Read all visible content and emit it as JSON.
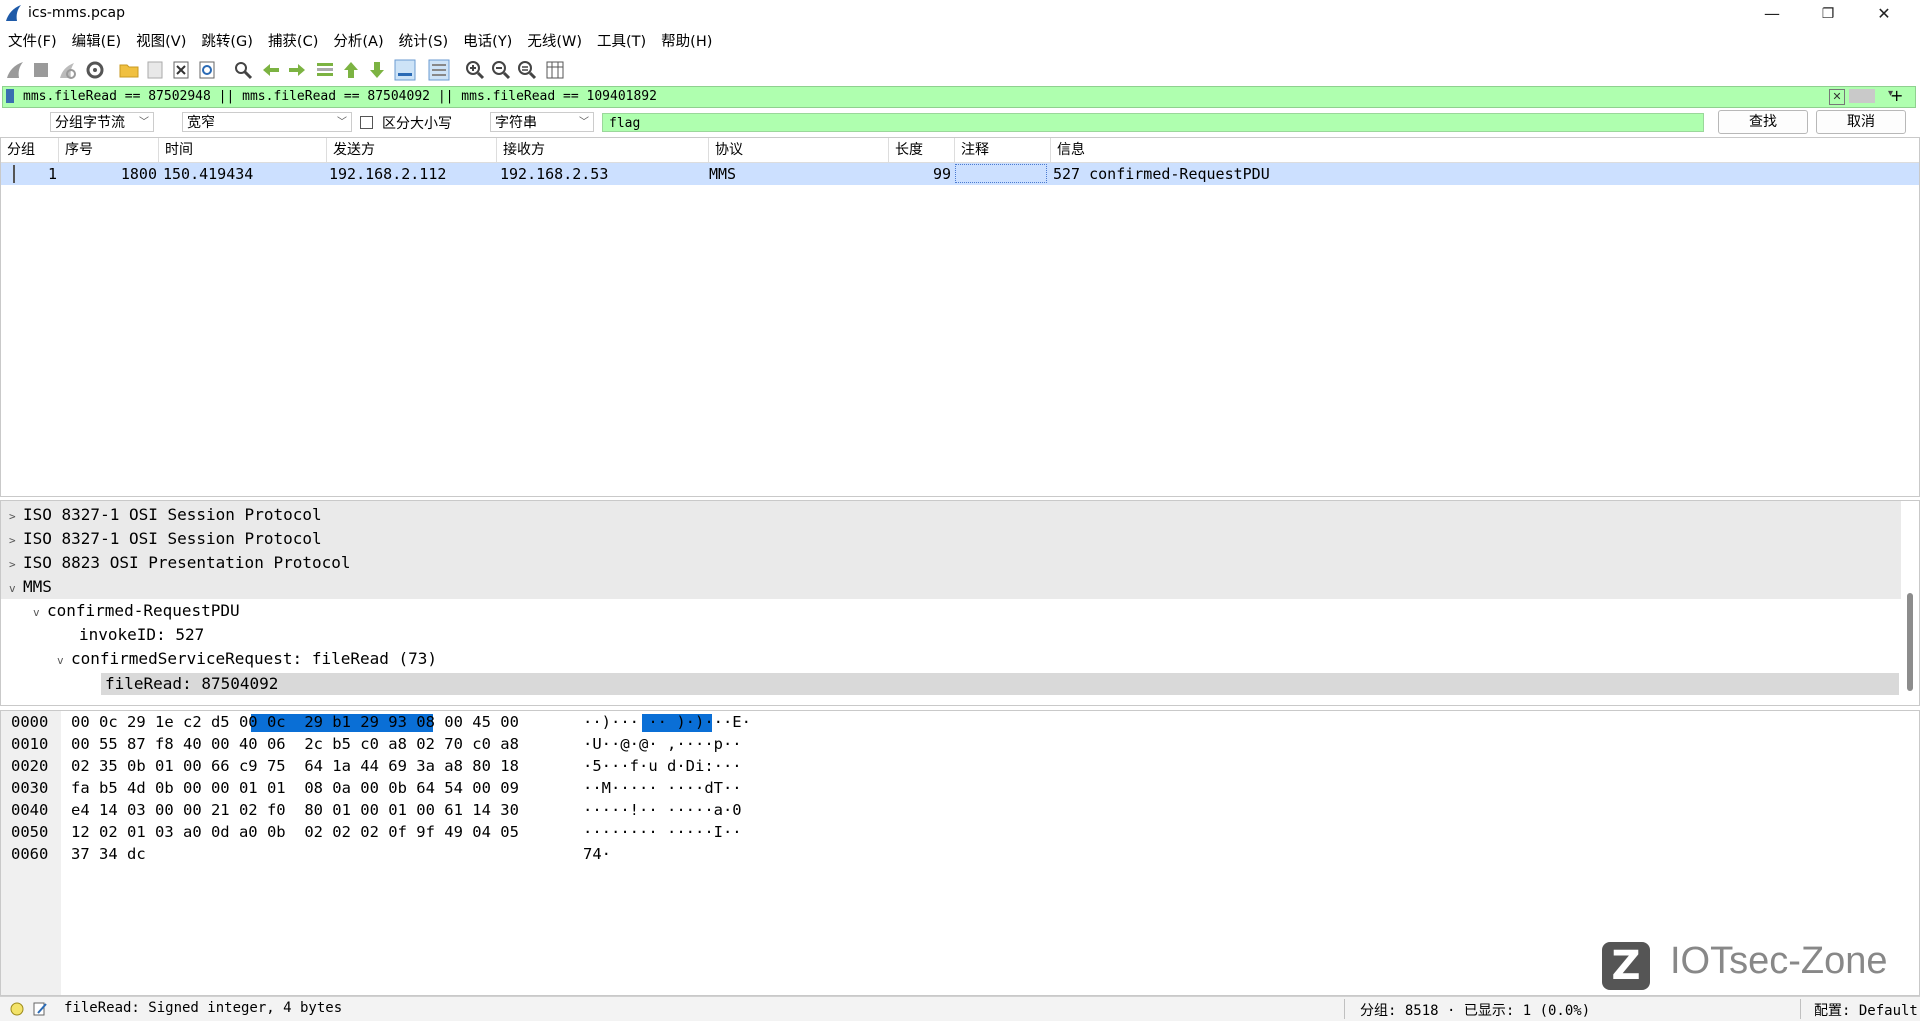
{
  "window": {
    "title": "ics-mms.pcap",
    "minimize": "—",
    "maximize": "❐",
    "close": "✕"
  },
  "menu": [
    "文件(F)",
    "编辑(E)",
    "视图(V)",
    "跳转(G)",
    "捕获(C)",
    "分析(A)",
    "统计(S)",
    "电话(Y)",
    "无线(W)",
    "工具(T)",
    "帮助(H)"
  ],
  "toolbar": [
    "shark-fin-start-icon",
    "stop-icon",
    "restart-icon",
    "options-gear-icon",
    "open-folder-icon",
    "save-icon",
    "close-file-icon",
    "reload-icon",
    "find-icon",
    "go-back-icon",
    "go-forward-icon",
    "go-to-packet-icon",
    "first-packet-icon",
    "last-packet-icon",
    "autoscroll-icon",
    "colorize-icon",
    "zoom-in-icon",
    "zoom-out-icon",
    "normal-size-icon",
    "resize-columns-icon"
  ],
  "display_filter": {
    "value": "mms.fileRead == 87502948 || mms.fileRead == 87504092 || mms.fileRead == 109401892",
    "add": "+"
  },
  "find": {
    "search_in": "分组字节流",
    "charset": "宽窄",
    "case_label": "区分大小写",
    "type": "字符串",
    "query": "flag",
    "find_button": "查找",
    "cancel_button": "取消"
  },
  "packet_list": {
    "columns": [
      "分组",
      "序号",
      "时间",
      "发送方",
      "接收方",
      "协议",
      "长度",
      "注释",
      "信息"
    ],
    "rows": [
      {
        "group": "1",
        "no": "1800",
        "time": "150.419434",
        "src": "192.168.2.112",
        "dst": "192.168.2.53",
        "proto": "MMS",
        "len": "99",
        "comment": "",
        "info": "527 confirmed-RequestPDU"
      }
    ]
  },
  "details": [
    "ISO 8327-1 OSI Session Protocol",
    "ISO 8327-1 OSI Session Protocol",
    "ISO 8823 OSI Presentation Protocol",
    "MMS",
    "confirmed-RequestPDU",
    "invokeID: 527",
    "confirmedServiceRequest: fileRead (73)",
    "fileRead: 87504092"
  ],
  "bytes": [
    {
      "off": "0000",
      "hex1": "00 0c 29 1e c2 d5 00 0c",
      "hex2": "29 b1 29 93 08 00 45 00",
      "ascii": "··)··· ·· )·)···E·"
    },
    {
      "off": "0010",
      "hex1": "00 55 87 f8 40 00 40 06",
      "hex2": "2c b5 c0 a8 02 70 c0 a8",
      "ascii": "·U··@·@· ,····p··"
    },
    {
      "off": "0020",
      "hex1": "02 35 0b 01 00 66 c9 75",
      "hex2": "64 1a 44 69 3a a8 80 18",
      "ascii": "·5···f·u d·Di:···"
    },
    {
      "off": "0030",
      "hex1": "fa b5 4d 0b 00 00 01 01",
      "hex2": "08 0a 00 0b 64 54 00 09",
      "ascii": "··M····· ····dT··"
    },
    {
      "off": "0040",
      "hex1": "e4 14 03 00 00 21 02 f0",
      "hex2": "80 01 00 01 00 61 14 30",
      "ascii": "·····!·· ·····a·0"
    },
    {
      "off": "0050",
      "hex1": "12 02 01 03 a0 0d a0 0b",
      "hex2": "02 02 02 0f 9f 49 04 05",
      "ascii": "········ ·····I··"
    },
    {
      "off": "0060",
      "hex1": "37 34 dc",
      "hex2": "",
      "ascii": "74·"
    }
  ],
  "status": {
    "field_info": "fileRead: Signed integer, 4 bytes",
    "packets": "分组: 8518 · 已显示: 1 (0.0%)",
    "profile": "配置: Default"
  },
  "watermark": {
    "logo": "Z",
    "text": "IOTsec-Zone"
  }
}
